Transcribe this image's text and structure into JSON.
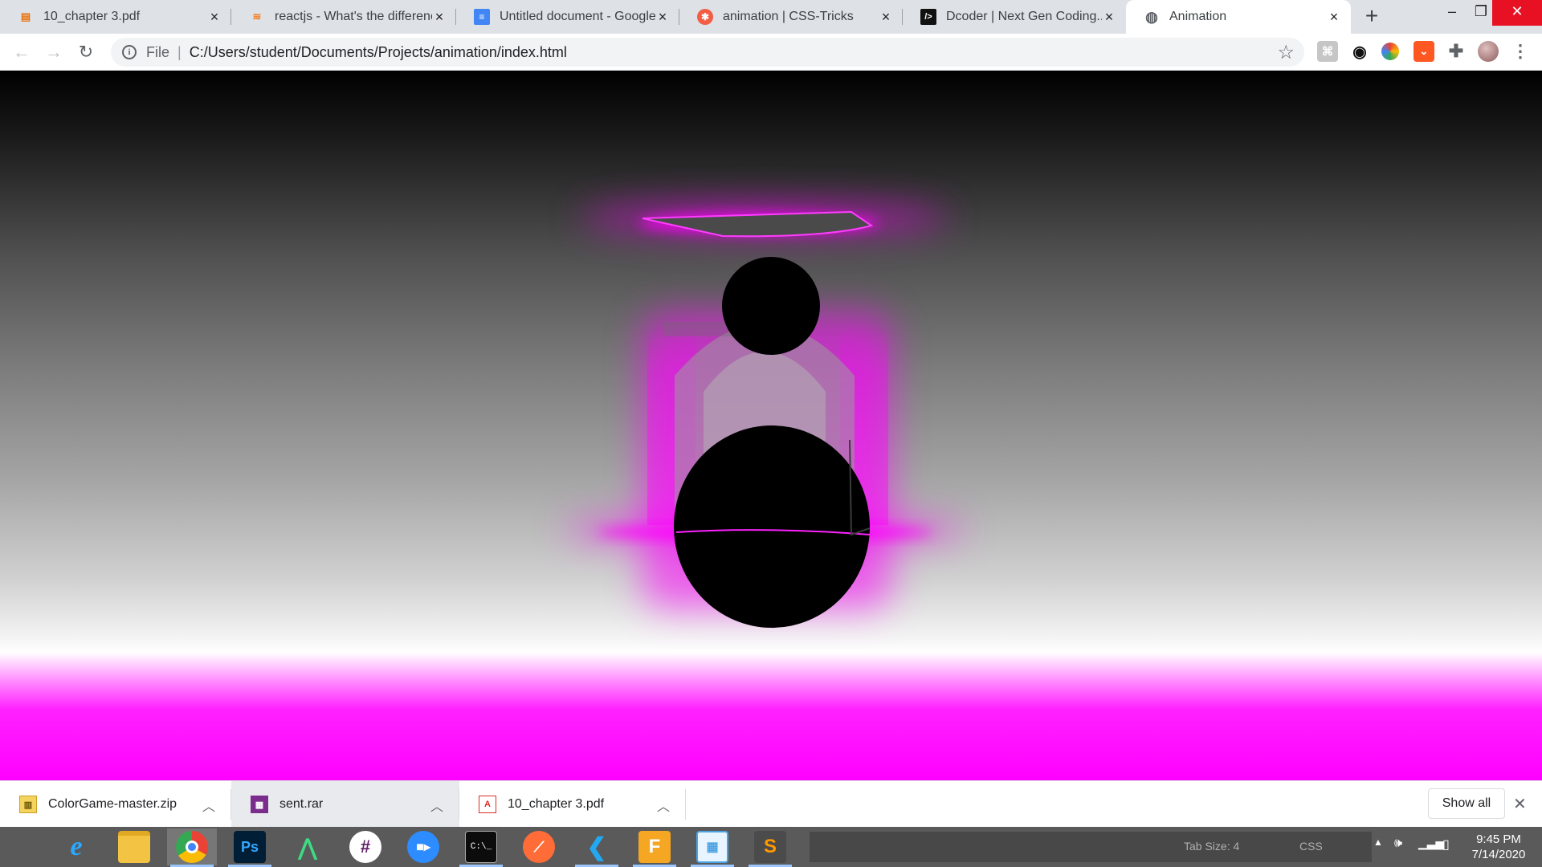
{
  "browser": {
    "tabs": [
      {
        "title": "10_chapter 3.pdf",
        "icon": "pdf-icon"
      },
      {
        "title": "reactjs - What's the difference",
        "icon": "stackoverflow-icon"
      },
      {
        "title": "Untitled document - Google D",
        "icon": "google-docs-icon"
      },
      {
        "title": "animation | CSS-Tricks",
        "icon": "css-tricks-icon"
      },
      {
        "title": "Dcoder | Next Gen Coding...",
        "icon": "dcoder-icon"
      },
      {
        "title": "Animation",
        "icon": "globe-icon",
        "active": true
      }
    ],
    "new_tab_label": "+",
    "window": {
      "minimize": "–",
      "restore": "❐",
      "close": "✕"
    }
  },
  "toolbar": {
    "back": "←",
    "forward": "→",
    "reload": "↻",
    "url_protocol": "File",
    "url": "C:/Users/student/Documents/Projects/animation/index.html",
    "bookmark_icon": "☆"
  },
  "page": {
    "background": {
      "top": "#000000",
      "middle": "#808080",
      "bottom": "#ff00ff"
    },
    "glow_color": "#ff00ff",
    "shape_color": "#000000"
  },
  "downloads": {
    "items": [
      {
        "name": "ColorGame-master.zip",
        "icon": "zip-file-icon"
      },
      {
        "name": "sent.rar",
        "icon": "rar-file-icon"
      },
      {
        "name": "10_chapter 3.pdf",
        "icon": "pdf-file-icon"
      }
    ],
    "show_all": "Show all",
    "close": "✕"
  },
  "taskbar": {
    "apps": [
      {
        "name": "windows-start-icon",
        "label": ""
      },
      {
        "name": "internet-explorer-icon",
        "label": "e"
      },
      {
        "name": "file-explorer-icon",
        "label": ""
      },
      {
        "name": "chrome-icon",
        "label": ""
      },
      {
        "name": "photoshop-icon",
        "label": "Ps"
      },
      {
        "name": "android-studio-icon",
        "label": ""
      },
      {
        "name": "slack-icon",
        "label": ""
      },
      {
        "name": "zoom-icon",
        "label": ""
      },
      {
        "name": "command-prompt-icon",
        "label": "C:\\_"
      },
      {
        "name": "postman-icon",
        "label": ""
      },
      {
        "name": "vscode-icon",
        "label": ""
      },
      {
        "name": "fusion-360-icon",
        "label": "F"
      },
      {
        "name": "calendar-app-icon",
        "label": ""
      },
      {
        "name": "sublime-text-icon",
        "label": "S"
      }
    ],
    "status_tab_size": "Tab Size: 4",
    "status_syntax": "CSS",
    "time": "9:45 PM",
    "date": "7/14/2020"
  }
}
